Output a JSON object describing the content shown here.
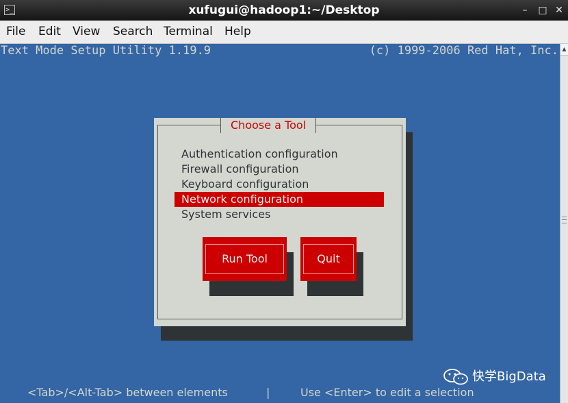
{
  "window": {
    "title": "xufugui@hadoop1:~/Desktop",
    "icon": "terminal-icon",
    "minimize": "–",
    "maximize": "□",
    "close": "✕"
  },
  "menubar": [
    "File",
    "Edit",
    "View",
    "Search",
    "Terminal",
    "Help"
  ],
  "terminal": {
    "header_left": "Text Mode Setup Utility 1.19.9",
    "header_right": "(c) 1999-2006 Red Hat, Inc.",
    "dialog": {
      "title": "Choose a Tool",
      "items": [
        "Authentication configuration",
        "Firewall configuration",
        "Keyboard configuration",
        "Network configuration",
        "System services"
      ],
      "selected_index": 3,
      "buttons": [
        "Run Tool",
        "Quit"
      ]
    },
    "footer_left": "<Tab>/<Alt-Tab> between elements",
    "footer_sep": "|",
    "footer_right": "Use <Enter> to edit a selection"
  },
  "watermark": {
    "text": "快学BigData",
    "icon": "wechat-icon"
  },
  "colors": {
    "terminal_bg": "#3465a4",
    "dialog_bg": "#d3d7cf",
    "accent_red": "#cc0000",
    "shadow": "#2e3436"
  }
}
